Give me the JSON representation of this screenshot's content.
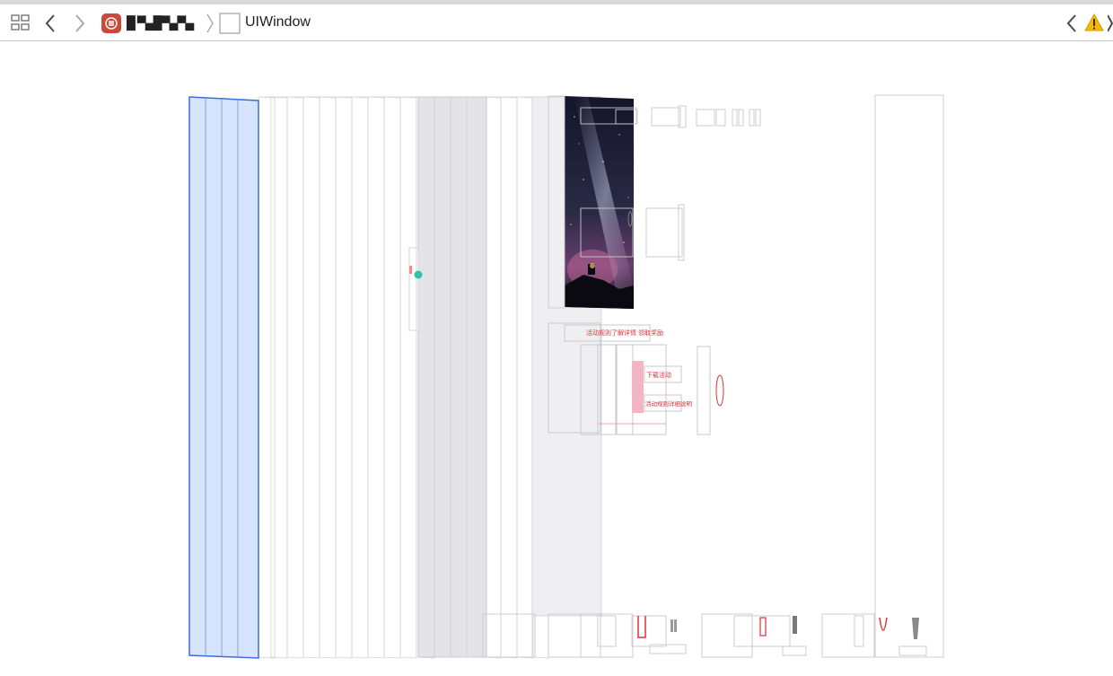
{
  "toolbar": {
    "grid_icon": "grid-icon",
    "back_icon": "chevron-left-icon",
    "forward_icon": "chevron-right-icon",
    "app_icon": "app-icon",
    "app_name": "█ ▀▄█▀▄▀▄",
    "breadcrumb_separator": "chevron-right-icon",
    "window_icon": "window-icon",
    "current_item": "UIWindow",
    "right_back_icon": "chevron-left-icon",
    "warning_icon": "warning-triangle-icon"
  },
  "colors": {
    "selection_fill": "#d6e4fd",
    "selection_stroke": "#3a6fd8",
    "layer_stroke": "#c9c9c9",
    "accent_red": "#e0303a",
    "warning": "#f5b800"
  },
  "canvas": {
    "label": "3D view hierarchy",
    "banner_text": "活动规则了解详情 领取奖励",
    "card_line_1": "下载活动",
    "card_line_2": "活动规则详细说明"
  }
}
